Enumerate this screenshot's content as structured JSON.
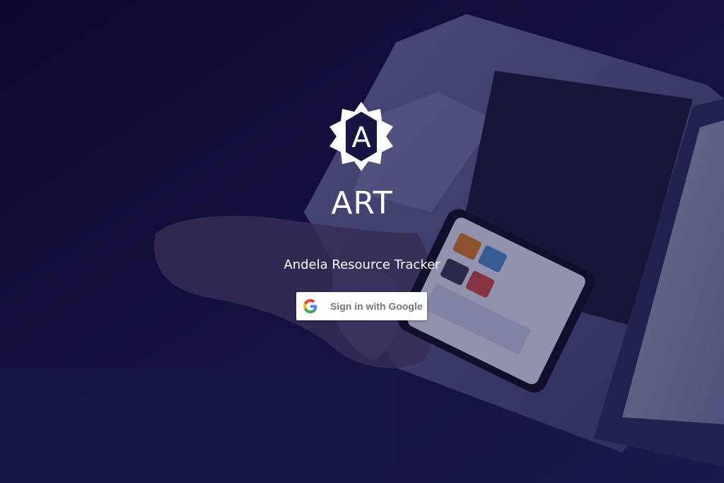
{
  "app": {
    "title": "ART",
    "subtitle": "Andela Resource Tracker",
    "logo_letter": "A",
    "logo_icon": "andela-star-logo-icon"
  },
  "signin": {
    "button_label": "Sign in with Google",
    "icon": "google-g-icon"
  },
  "colors": {
    "overlay": "#0d0b33",
    "text": "#ffffff",
    "button_bg": "#ffffff",
    "button_text": "#757575",
    "google_blue": "#4285F4",
    "google_red": "#EA4335",
    "google_yellow": "#FBBC05",
    "google_green": "#34A853"
  }
}
